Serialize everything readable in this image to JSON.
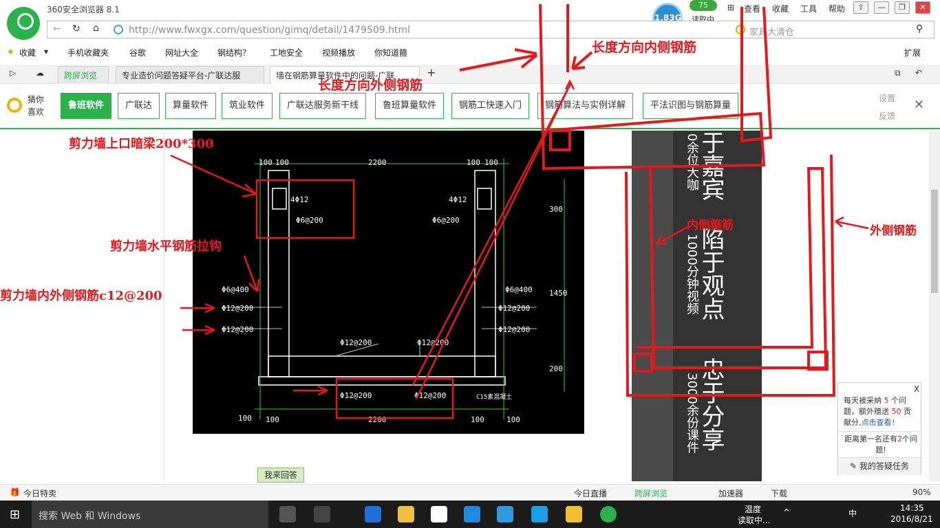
{
  "browser": {
    "name": "360安全浏览器 8.1",
    "menu": [
      "查看",
      "收藏",
      "工具",
      "帮助"
    ],
    "speed": "1.83G",
    "speed_badge": "75",
    "speed_label": "读取中...",
    "window_controls": [
      "—",
      "❐",
      "✕"
    ]
  },
  "address": {
    "url": "http://www.fwxgx.com/question/gimq/detail/1479509.html",
    "search_placeholder": "家具大清仓"
  },
  "bookmarks": {
    "fav_label": "收藏",
    "items": [
      "手机收藏夹",
      "谷歌",
      "网址大全",
      "钢结构？",
      "工地安全",
      "视频播放",
      "你知道箍"
    ],
    "ext_label": "扩展"
  },
  "tabs": [
    {
      "label": "跨屏浏览"
    },
    {
      "label": "专业造价问题答疑平台-广联达服"
    },
    {
      "label": "墙在钢筋算量软件中的问题-广联"
    }
  ],
  "keywords": {
    "guess_label": "猜你喜欢",
    "items": [
      "鲁班软件",
      "广联达",
      "算量软件",
      "筑业软件",
      "广联达服务新干线",
      "鲁班算量软件",
      "钢筋工快速入门",
      "钢筋算法与实例详解",
      "平法识图与钢筋算量"
    ],
    "settings": "设置",
    "feedback": "反馈"
  },
  "annotations": {
    "a1": "剪力墙上口暗梁200*300",
    "a2": "剪力墙水平钢筋拉钩",
    "a3": "剪力墙内外侧钢筋c12@200",
    "a4": "长度方向内侧钢筋",
    "a5": "长度方向外侧钢筋",
    "a6": "内侧箍筋",
    "a7": "外侧钢筋"
  },
  "cad": {
    "dims": [
      "100",
      "100",
      "2200",
      "100",
      "100",
      "300",
      "1450",
      "200",
      "100",
      "2200",
      "100",
      "100",
      "100"
    ],
    "labels": [
      "4Φ12",
      "Φ6@200",
      "4Φ12",
      "Φ6@200",
      "Φ6@400",
      "Φ12@200",
      "Φ12@200",
      "Φ6@400",
      "Φ12@200",
      "Φ12@200",
      "Φ12@200",
      "Φ12@200",
      "Φ12@200",
      "Φ12@200",
      "C15素混凝土"
    ]
  },
  "ad": {
    "col1": "0余位大咖",
    "col2": "于嘉宾",
    "col3": "陷于观点",
    "col4": "1000分钟视频",
    "col5": "忠于分享",
    "col6": "3000余份课件"
  },
  "popup": {
    "close": "X",
    "line1a": "每天被采纳 ",
    "num1": "5",
    "line1b": " 个问题，额外赠送 ",
    "num2": "50",
    "line1c": " 贡献分,",
    "link": "点击查看！",
    "line2a": "距离第一名还有",
    "num3": "2",
    "line2b": "个问题!",
    "task": "我的答疑任务"
  },
  "answer_button": "我来回答",
  "statusbar": {
    "left": "今日特卖",
    "items": [
      "今日直播",
      "跨屏浏览",
      "加速器",
      "下载"
    ],
    "zoom": "90%"
  },
  "taskbar": {
    "search": "搜索 Web 和 Windows",
    "weather1": "温度",
    "weather2": "读取中...",
    "ime": "中",
    "time": "14:35",
    "date": "2016/8/21"
  },
  "colors": {
    "brand": "#2bb24c",
    "annotation": "#e8171b"
  }
}
